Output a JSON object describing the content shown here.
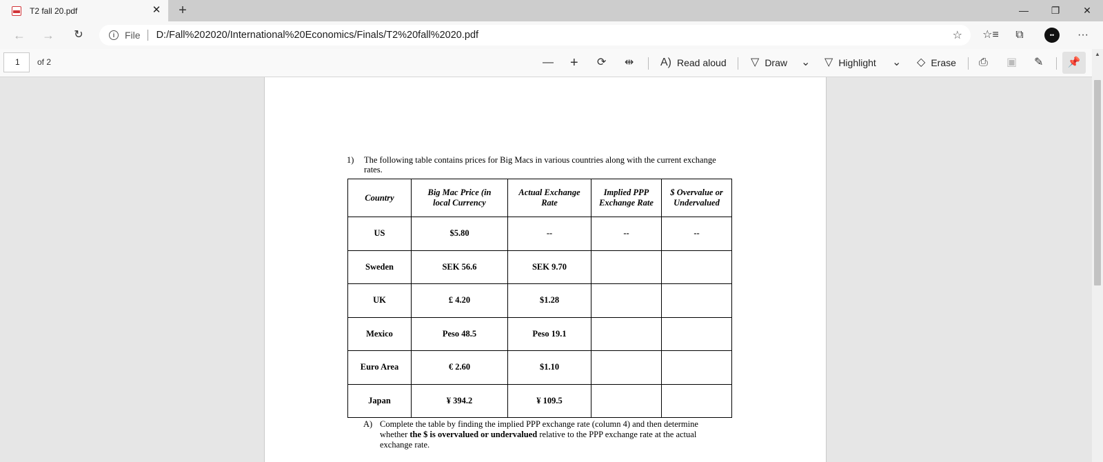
{
  "browser": {
    "tab_title": "T2 fall 20.pdf",
    "tab_close": "✕",
    "new_tab": "+",
    "window_buttons": {
      "minimize": "—",
      "restore": "❐",
      "close": "✕"
    },
    "address": {
      "file_label": "File",
      "url": "D:/Fall%202020/International%20Economics/Finals/T2%20fall%2020.pdf"
    }
  },
  "pdf_toolbar": {
    "page_number": "1",
    "page_of": "of 2",
    "read_aloud": "Read aloud",
    "draw": "Draw",
    "highlight": "Highlight",
    "erase": "Erase"
  },
  "document": {
    "question_number": "1)",
    "question_line1": "The following table contains prices for Big Macs in various countries along with the current exchange",
    "question_line2": "rates.",
    "table": {
      "headers": {
        "country": "Country",
        "price_line1": "Big Mac Price (in",
        "price_line2": "local Currency",
        "actual_line1": "Actual Exchange",
        "actual_line2": "Rate",
        "implied_line1": "Implied PPP",
        "implied_line2": "Exchange Rate",
        "over_line1": "$ Overvalue or",
        "over_line2": "Undervalued"
      },
      "rows": [
        {
          "country": "US",
          "price": "$5.80",
          "actual": "--",
          "implied": "--",
          "over": "--"
        },
        {
          "country": "Sweden",
          "price": "SEK 56.6",
          "actual": "SEK 9.70",
          "implied": "",
          "over": ""
        },
        {
          "country": "UK",
          "price": "£ 4.20",
          "actual": "$1.28",
          "implied": "",
          "over": ""
        },
        {
          "country": "Mexico",
          "price": "Peso 48.5",
          "actual": "Peso 19.1",
          "implied": "",
          "over": ""
        },
        {
          "country": "Euro Area",
          "price": "€ 2.60",
          "actual": "$1.10",
          "implied": "",
          "over": ""
        },
        {
          "country": "Japan",
          "price": "¥ 394.2",
          "actual": "¥ 109.5",
          "implied": "",
          "over": ""
        }
      ]
    },
    "part_a": {
      "letter": "A)",
      "text_before": "Complete the table by finding the implied PPP exchange rate (column 4) and then determine whether ",
      "text_bold": "the $ is overvalued or undervalued",
      "text_after": " relative to the PPP exchange rate at the actual exchange rate."
    }
  }
}
